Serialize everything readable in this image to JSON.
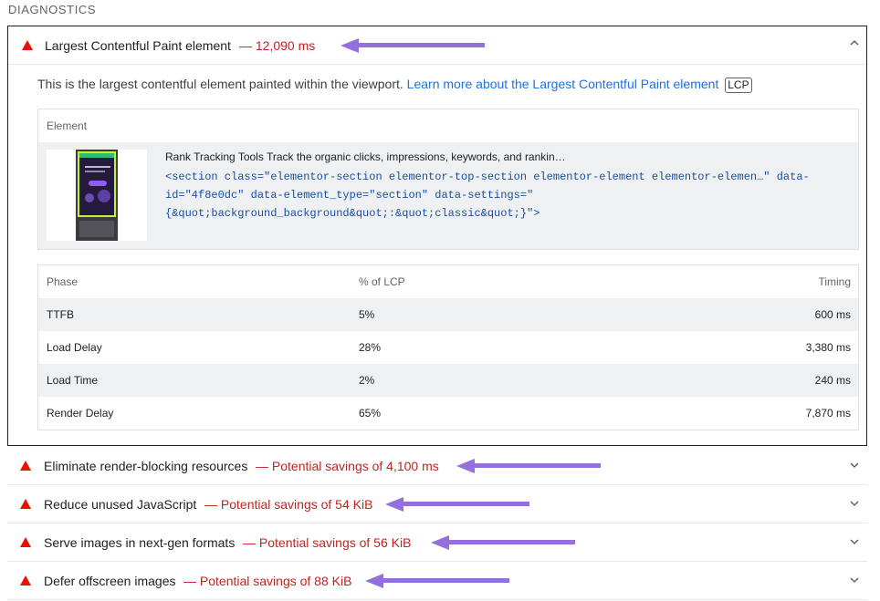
{
  "section_title": "DIAGNOSTICS",
  "lcp_audit": {
    "title": "Largest Contentful Paint element",
    "display_value": "— 12,090 ms",
    "description": "This is the largest contentful element painted within the viewport.",
    "learn_more": "Learn more about the Largest Contentful Paint element",
    "badge": "LCP",
    "element_table": {
      "header": "Element",
      "node_label": "Rank Tracking Tools Track the organic clicks, impressions, keywords, and rankin…",
      "node_snippet": "<section class=\"elementor-section elementor-top-section elementor-element elementor-elemen…\" data-id=\"4f8e0dc\" data-element_type=\"section\" data-settings=\"{&quot;background_background&quot;:&quot;classic&quot;}\">"
    },
    "phase_table": {
      "headers": [
        "Phase",
        "% of LCP",
        "Timing"
      ],
      "rows": [
        {
          "phase": "TTFB",
          "percent": "5%",
          "timing": "600 ms"
        },
        {
          "phase": "Load Delay",
          "percent": "28%",
          "timing": "3,380 ms"
        },
        {
          "phase": "Load Time",
          "percent": "2%",
          "timing": "240 ms"
        },
        {
          "phase": "Render Delay",
          "percent": "65%",
          "timing": "7,870 ms"
        }
      ]
    }
  },
  "audits": [
    {
      "title": "Eliminate render-blocking resources",
      "display_value": "— Potential savings of 4,100 ms"
    },
    {
      "title": "Reduce unused JavaScript",
      "display_value": "— Potential savings of 54 KiB"
    },
    {
      "title": "Serve images in next-gen formats",
      "display_value": "— Potential savings of 56 KiB"
    },
    {
      "title": "Defer offscreen images",
      "display_value": "— Potential savings of 88 KiB"
    }
  ],
  "icons": {
    "fail": "warning-triangle-icon",
    "expand": "chevron-down-icon",
    "collapse": "chevron-up-icon",
    "annotation": "arrow-left-annotation"
  },
  "colors": {
    "fail_red": "#eb0f00",
    "display_red": "#c5221f",
    "link_blue": "#1a73e8",
    "annotation_purple": "#9370db",
    "row_shade": "#eef0f2"
  }
}
